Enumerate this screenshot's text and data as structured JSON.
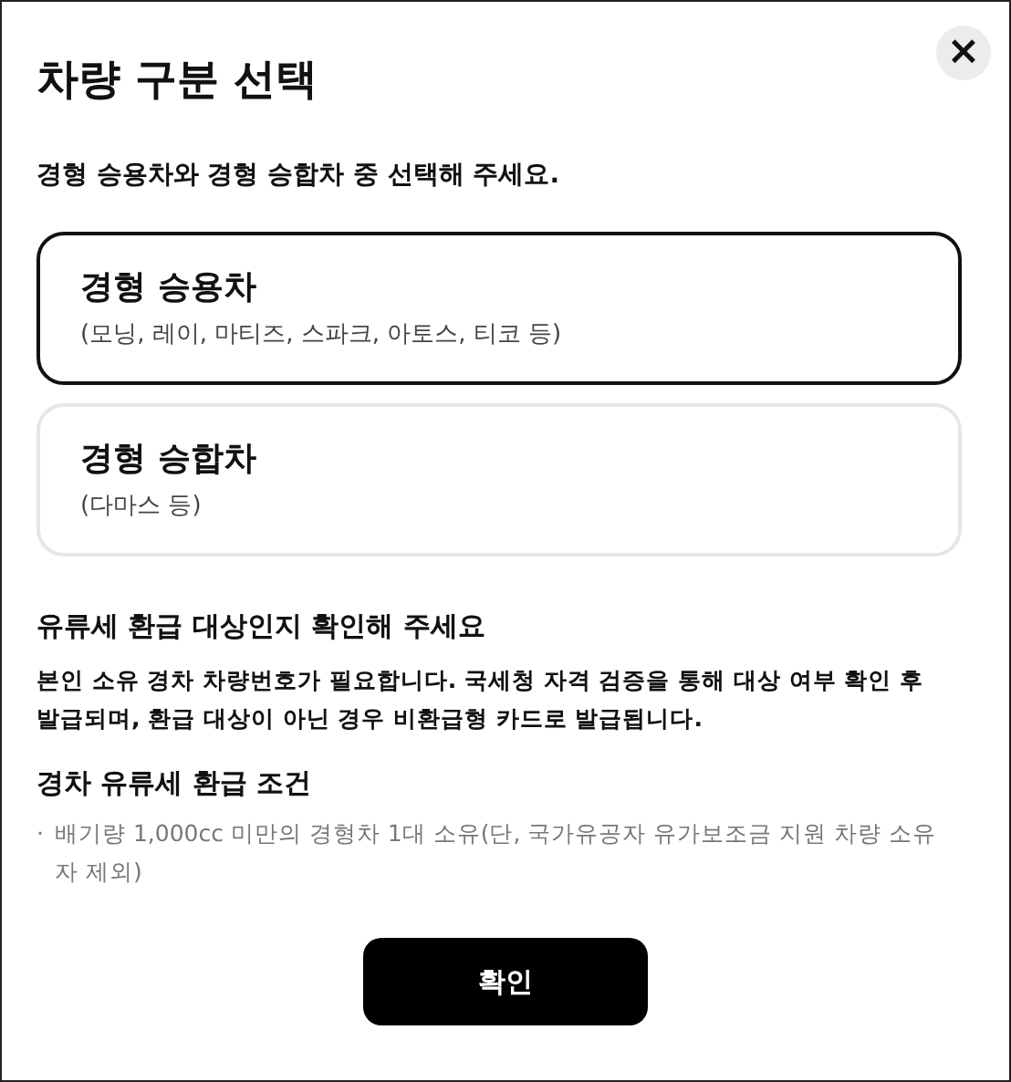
{
  "dialog": {
    "title": "차량 구분 선택",
    "close_icon": "×",
    "subtitle": "경형 승용차와 경형 승합차 중 선택해 주세요."
  },
  "options": [
    {
      "title": "경형 승용차",
      "detail": "(모닝, 레이, 마티즈, 스파크, 아토스, 티코 등)",
      "selected": true
    },
    {
      "title": "경형 승합차",
      "detail": "(다마스 등)",
      "selected": false
    }
  ],
  "notice": {
    "heading": "유류세 환급 대상인지 확인해 주세요",
    "text": "본인 소유 경차 차량번호가 필요합니다. 국세청 자격 검증을 통해 대상 여부 확인 후 발급되며, 환급 대상이 아닌 경우 비환급형 카드로 발급됩니다."
  },
  "conditions": {
    "heading": "경차 유류세 환급 조건",
    "items": [
      {
        "bullet": "·",
        "text": "배기량 1,000cc 미만의 경형차 1대 소유(단, 국가유공자 유가보조금 지원 차량 소유자 제외)"
      }
    ]
  },
  "confirm_button": "확인"
}
